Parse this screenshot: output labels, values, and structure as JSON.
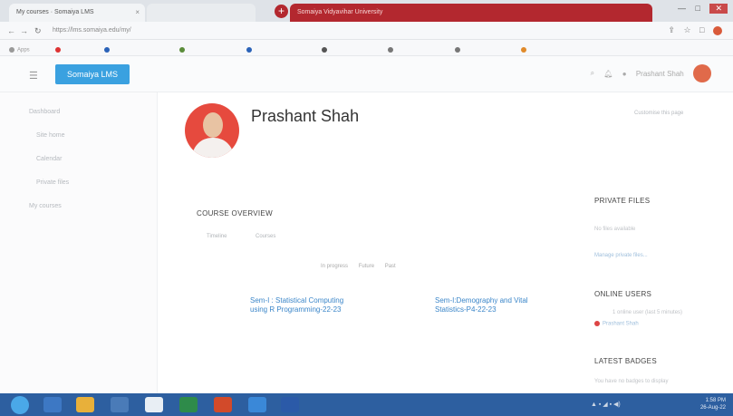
{
  "browser": {
    "tabs": [
      {
        "label": "My courses · Somaiya LMS",
        "active": true
      },
      {
        "label": "",
        "active": false
      },
      {
        "label": "Somaiya Vidyavihar University",
        "active": false
      }
    ],
    "new_tab": "+",
    "url": "https://lms.somaiya.edu/my/",
    "window_controls": {
      "min": "—",
      "max": "□",
      "close": "✕"
    },
    "bookmarks": [
      "Apps",
      "",
      "",
      "",
      "",
      "",
      "",
      "",
      "",
      "",
      "",
      ""
    ]
  },
  "header": {
    "brand": "Somaiya LMS",
    "user_menu": "Prashant Shah"
  },
  "sidebar": {
    "items": [
      "Dashboard",
      "Site home",
      "Calendar",
      "Private files",
      "My courses",
      "",
      "",
      "",
      "",
      "",
      "",
      "",
      ""
    ]
  },
  "profile": {
    "name": "Prashant Shah",
    "customise": "Customise this page"
  },
  "course_overview": {
    "title": "COURSE OVERVIEW",
    "tabs": [
      "Timeline",
      "Courses"
    ],
    "filters": [
      "In progress",
      "Future",
      "Past"
    ],
    "courses": [
      "Sem-I : Statistical Computing using R Programming-22-23",
      "Sem-I:Demography and Vital Statistics-P4-22-23"
    ]
  },
  "right": {
    "private_files_title": "PRIVATE FILES",
    "private_files_text": "No files available",
    "manage_files": "Manage private files...",
    "online_users_title": "ONLINE USERS",
    "online_users_text": "1 online user (last 5 minutes)",
    "online_user": "Prashant Shah",
    "latest_badges_title": "LATEST BADGES",
    "latest_badges_text": "You have no badges to display"
  },
  "taskbar": {
    "time": "1:58 PM",
    "date": "26-Aug-22"
  },
  "colors": {
    "brand": "#3aa1e0",
    "avatar_bg": "#e64a3e",
    "link": "#3b86c9",
    "taskbar": "#2d5fa0",
    "tab_active": "#b3282f"
  }
}
